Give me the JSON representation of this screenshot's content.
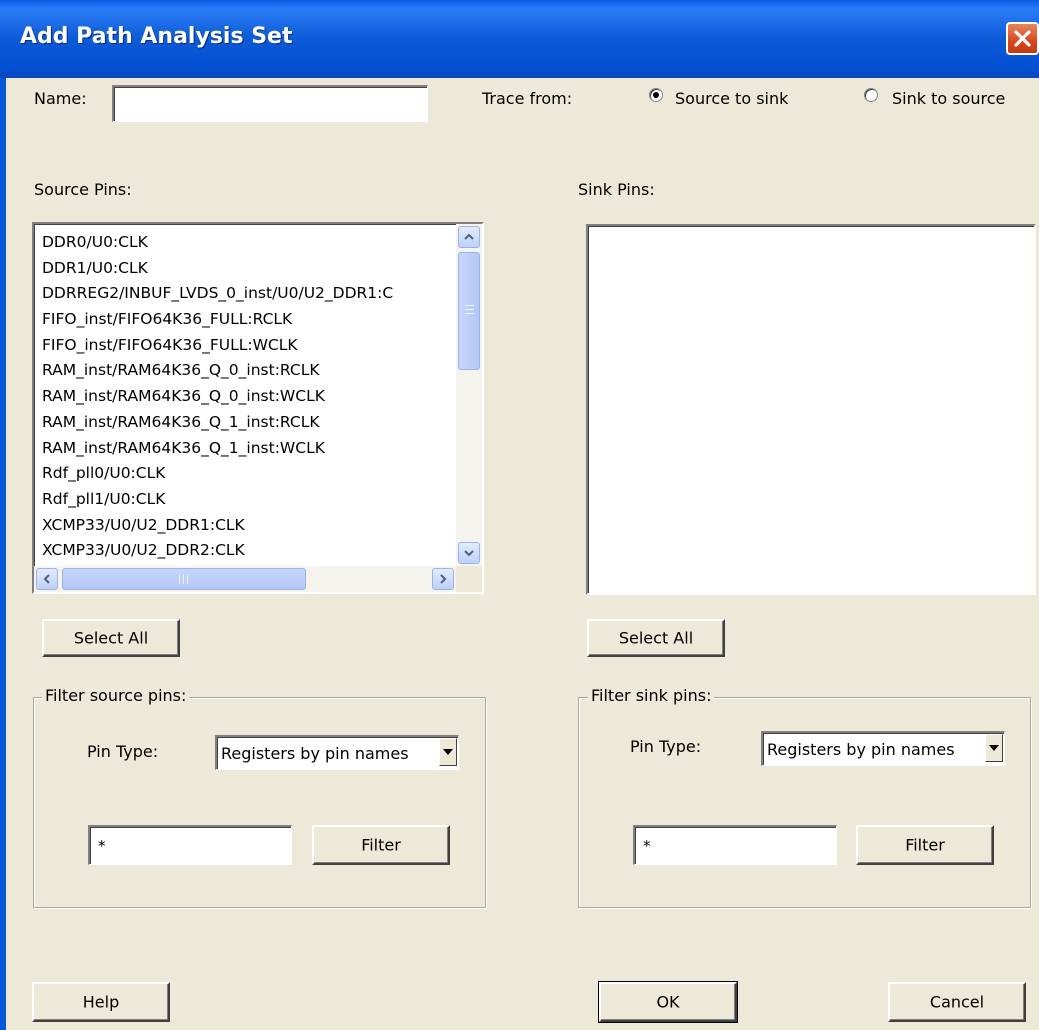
{
  "window": {
    "title": "Add Path Analysis Set"
  },
  "name_field": {
    "label": "Name:",
    "value": ""
  },
  "trace": {
    "label": "Trace from:",
    "options": [
      {
        "label": "Source to sink",
        "checked": true
      },
      {
        "label": "Sink to source",
        "checked": false
      }
    ]
  },
  "source": {
    "label": "Source Pins:",
    "items": [
      "DDR0/U0:CLK",
      "DDR1/U0:CLK",
      "DDRREG2/INBUF_LVDS_0_inst/U0/U2_DDR1:C",
      "FIFO_inst/FIFO64K36_FULL:RCLK",
      "FIFO_inst/FIFO64K36_FULL:WCLK",
      "RAM_inst/RAM64K36_Q_0_inst:RCLK",
      "RAM_inst/RAM64K36_Q_0_inst:WCLK",
      "RAM_inst/RAM64K36_Q_1_inst:RCLK",
      "RAM_inst/RAM64K36_Q_1_inst:WCLK",
      "Rdf_pll0/U0:CLK",
      "Rdf_pll1/U0:CLK",
      "XCMP33/U0/U2_DDR1:CLK",
      "XCMP33/U0/U2_DDR2:CLK"
    ],
    "select_all_label": "Select All",
    "filter": {
      "legend": "Filter source pins:",
      "pin_type_label": "Pin Type:",
      "pin_type_value": "Registers by pin names",
      "pattern": "*",
      "button_label": "Filter"
    }
  },
  "sink": {
    "label": "Sink Pins:",
    "items": [],
    "select_all_label": "Select All",
    "filter": {
      "legend": "Filter sink pins:",
      "pin_type_label": "Pin Type:",
      "pin_type_value": "Registers by pin names",
      "pattern": "*",
      "button_label": "Filter"
    }
  },
  "footer": {
    "help_label": "Help",
    "ok_label": "OK",
    "cancel_label": "Cancel"
  },
  "colors": {
    "titlebar": "#0a5ce5",
    "face": "#ece9d8",
    "close": "#d6481f"
  }
}
